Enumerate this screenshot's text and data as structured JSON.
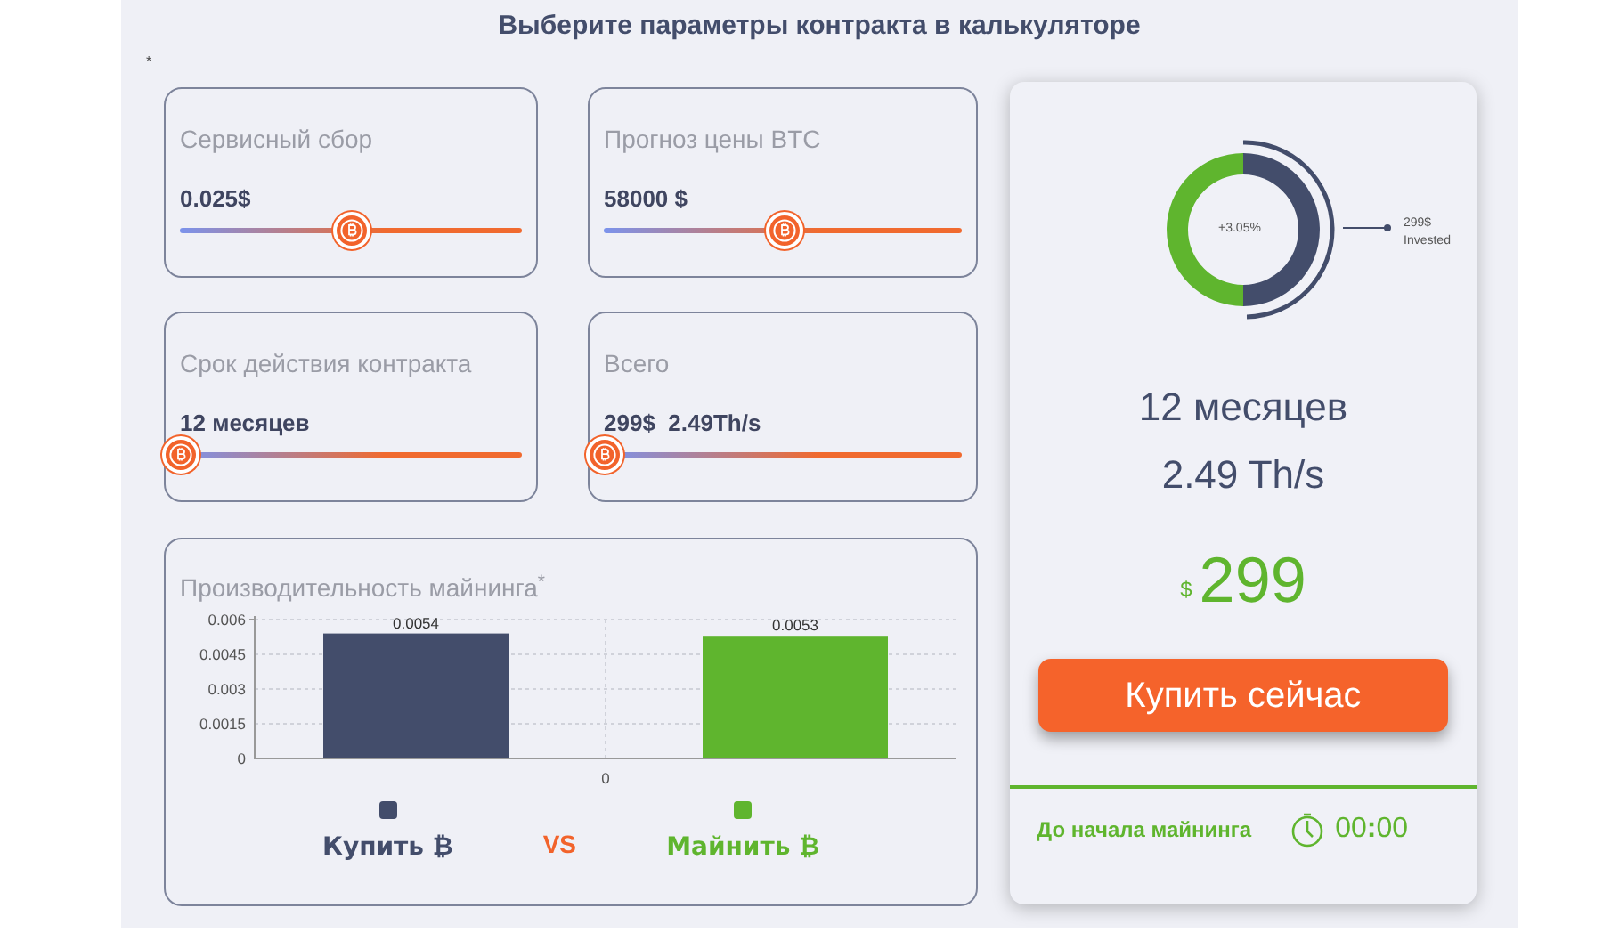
{
  "title": "Выберите параметры контракта в калькуляторе",
  "footnote_mark": "*",
  "sliders": [
    {
      "label": "Сервисный сбор",
      "value": "0.025$",
      "level": 0.5
    },
    {
      "label": "Прогноз цены BTC",
      "value": "58000 $",
      "level": 0.5
    },
    {
      "label": "Срок действия контракта",
      "value": "12 месяцев",
      "level": 0
    },
    {
      "label": "Всего",
      "value": "299$  2.49Th/s",
      "level": 0
    }
  ],
  "performance": {
    "title": "Производительность майнинга$^{*}$",
    "chart_data": {
      "type": "bar",
      "categories": [
        "0"
      ],
      "series": [
        {
          "name": "Купить ₿",
          "color": "#434d6b",
          "values": [
            0.0054
          ]
        },
        {
          "name": "Майнить ₿",
          "color": "#5fb52e",
          "values": [
            0.0053
          ]
        }
      ],
      "ylim": [
        0,
        0.006
      ],
      "yticks": [
        0,
        {
          "value": 0.0015,
          "label": "0.0015"
        },
        {
          "value": 0.003,
          "label": "0.003"
        },
        {
          "value": 0.0045,
          "label": "0.0045"
        },
        {
          "value": 0.006,
          "label": "0.006"
        }
      ],
      "data_labels": true,
      "grid": true
    },
    "vs": "VS"
  },
  "summary": {
    "donut_center": "+3.05%",
    "donut_label": [
      "299$",
      "Invested"
    ],
    "term": "12 месяцев",
    "hashrate": "2.49 Th/s",
    "currency": "$",
    "price": "299",
    "buy_button": "Купить сейчас",
    "countdown_label": "До начала майнинга",
    "countdown": "00**:**00"
  }
}
